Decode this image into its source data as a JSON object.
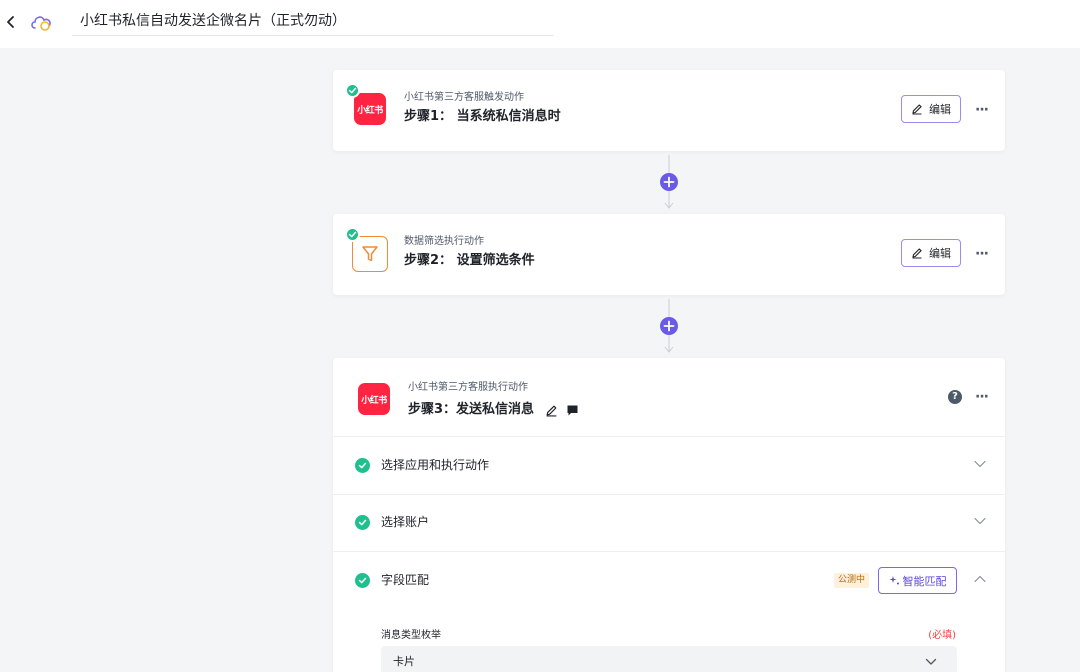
{
  "header": {
    "title": "小红书私信自动发送企微名片（正式勿动）",
    "back_icon": "chevron-left-icon",
    "logo_icon": "cloud-logo-icon"
  },
  "steps": [
    {
      "app_icon_text": "小红书",
      "subtitle": "小红书第三方客服触发动作",
      "title": "步骤1： 当系统私信消息时",
      "edit_label": "编辑",
      "more": "···",
      "status": "completed"
    },
    {
      "app_icon": "filter-icon",
      "subtitle": "数据筛选执行动作",
      "title": "步骤2： 设置筛选条件",
      "edit_label": "编辑",
      "more": "···",
      "status": "completed"
    },
    {
      "app_icon_text": "小红书",
      "subtitle": "小红书第三方客服执行动作",
      "title": "步骤3：发送私信消息",
      "more": "···",
      "help_icon": "question-circle-icon",
      "sections": [
        {
          "label": "选择应用和执行动作",
          "status": "completed",
          "expanded": false
        },
        {
          "label": "选择账户",
          "status": "completed",
          "expanded": false
        },
        {
          "label": "字段匹配",
          "status": "completed",
          "expanded": true,
          "badge": "公测中",
          "smart_label": "智能匹配"
        }
      ],
      "field": {
        "label": "消息类型枚举",
        "required": "(必填)",
        "value": "卡片"
      }
    }
  ],
  "colors": {
    "accent": "#6b5ae8",
    "success": "#1fbf8f",
    "xhs_red": "#ff2442",
    "filter_orange": "#f08c36",
    "required_red": "#f53f3f"
  }
}
